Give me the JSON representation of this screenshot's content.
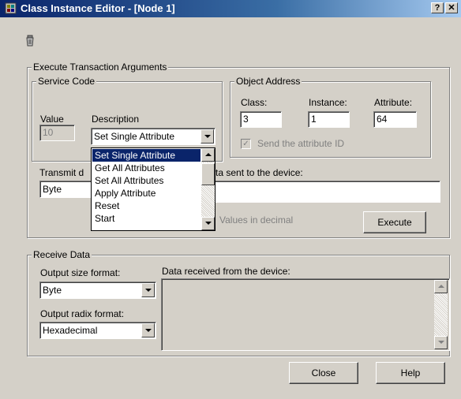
{
  "window": {
    "title": "Class Instance Editor - [Node 1]",
    "help_label": "?",
    "close_label": "✕"
  },
  "execute_group": {
    "legend": "Execute Transaction Arguments",
    "service_code": {
      "legend": "Service Code",
      "value_label": "Value",
      "value": "10",
      "description_label": "Description",
      "description_selected": "Set Single Attribute",
      "options": [
        "Set Single Attribute",
        "Get All Attributes",
        "Set All Attributes",
        "Apply Attribute",
        "Reset",
        "Start"
      ]
    },
    "object_address": {
      "legend": "Object Address",
      "class_label": "Class:",
      "class_value": "3",
      "instance_label": "Instance:",
      "instance_value": "1",
      "attribute_label": "Attribute:",
      "attribute_value": "64",
      "send_attr_label": "Send the attribute ID",
      "send_attr_checked": true
    },
    "transmit_label_left": "Transmit d",
    "transmit_label_right": "ta sent to the device:",
    "transmit_size": "Byte",
    "transmit_data": "",
    "values_decimal_label": "Values in decimal",
    "execute_label": "Execute"
  },
  "receive_group": {
    "legend": "Receive Data",
    "output_size_label": "Output size format:",
    "output_size_value": "Byte",
    "output_radix_label": "Output radix format:",
    "output_radix_value": "Hexadecimal",
    "data_received_label": "Data received from the device:",
    "data_received": ""
  },
  "footer": {
    "close_label": "Close",
    "help_label": "Help"
  }
}
